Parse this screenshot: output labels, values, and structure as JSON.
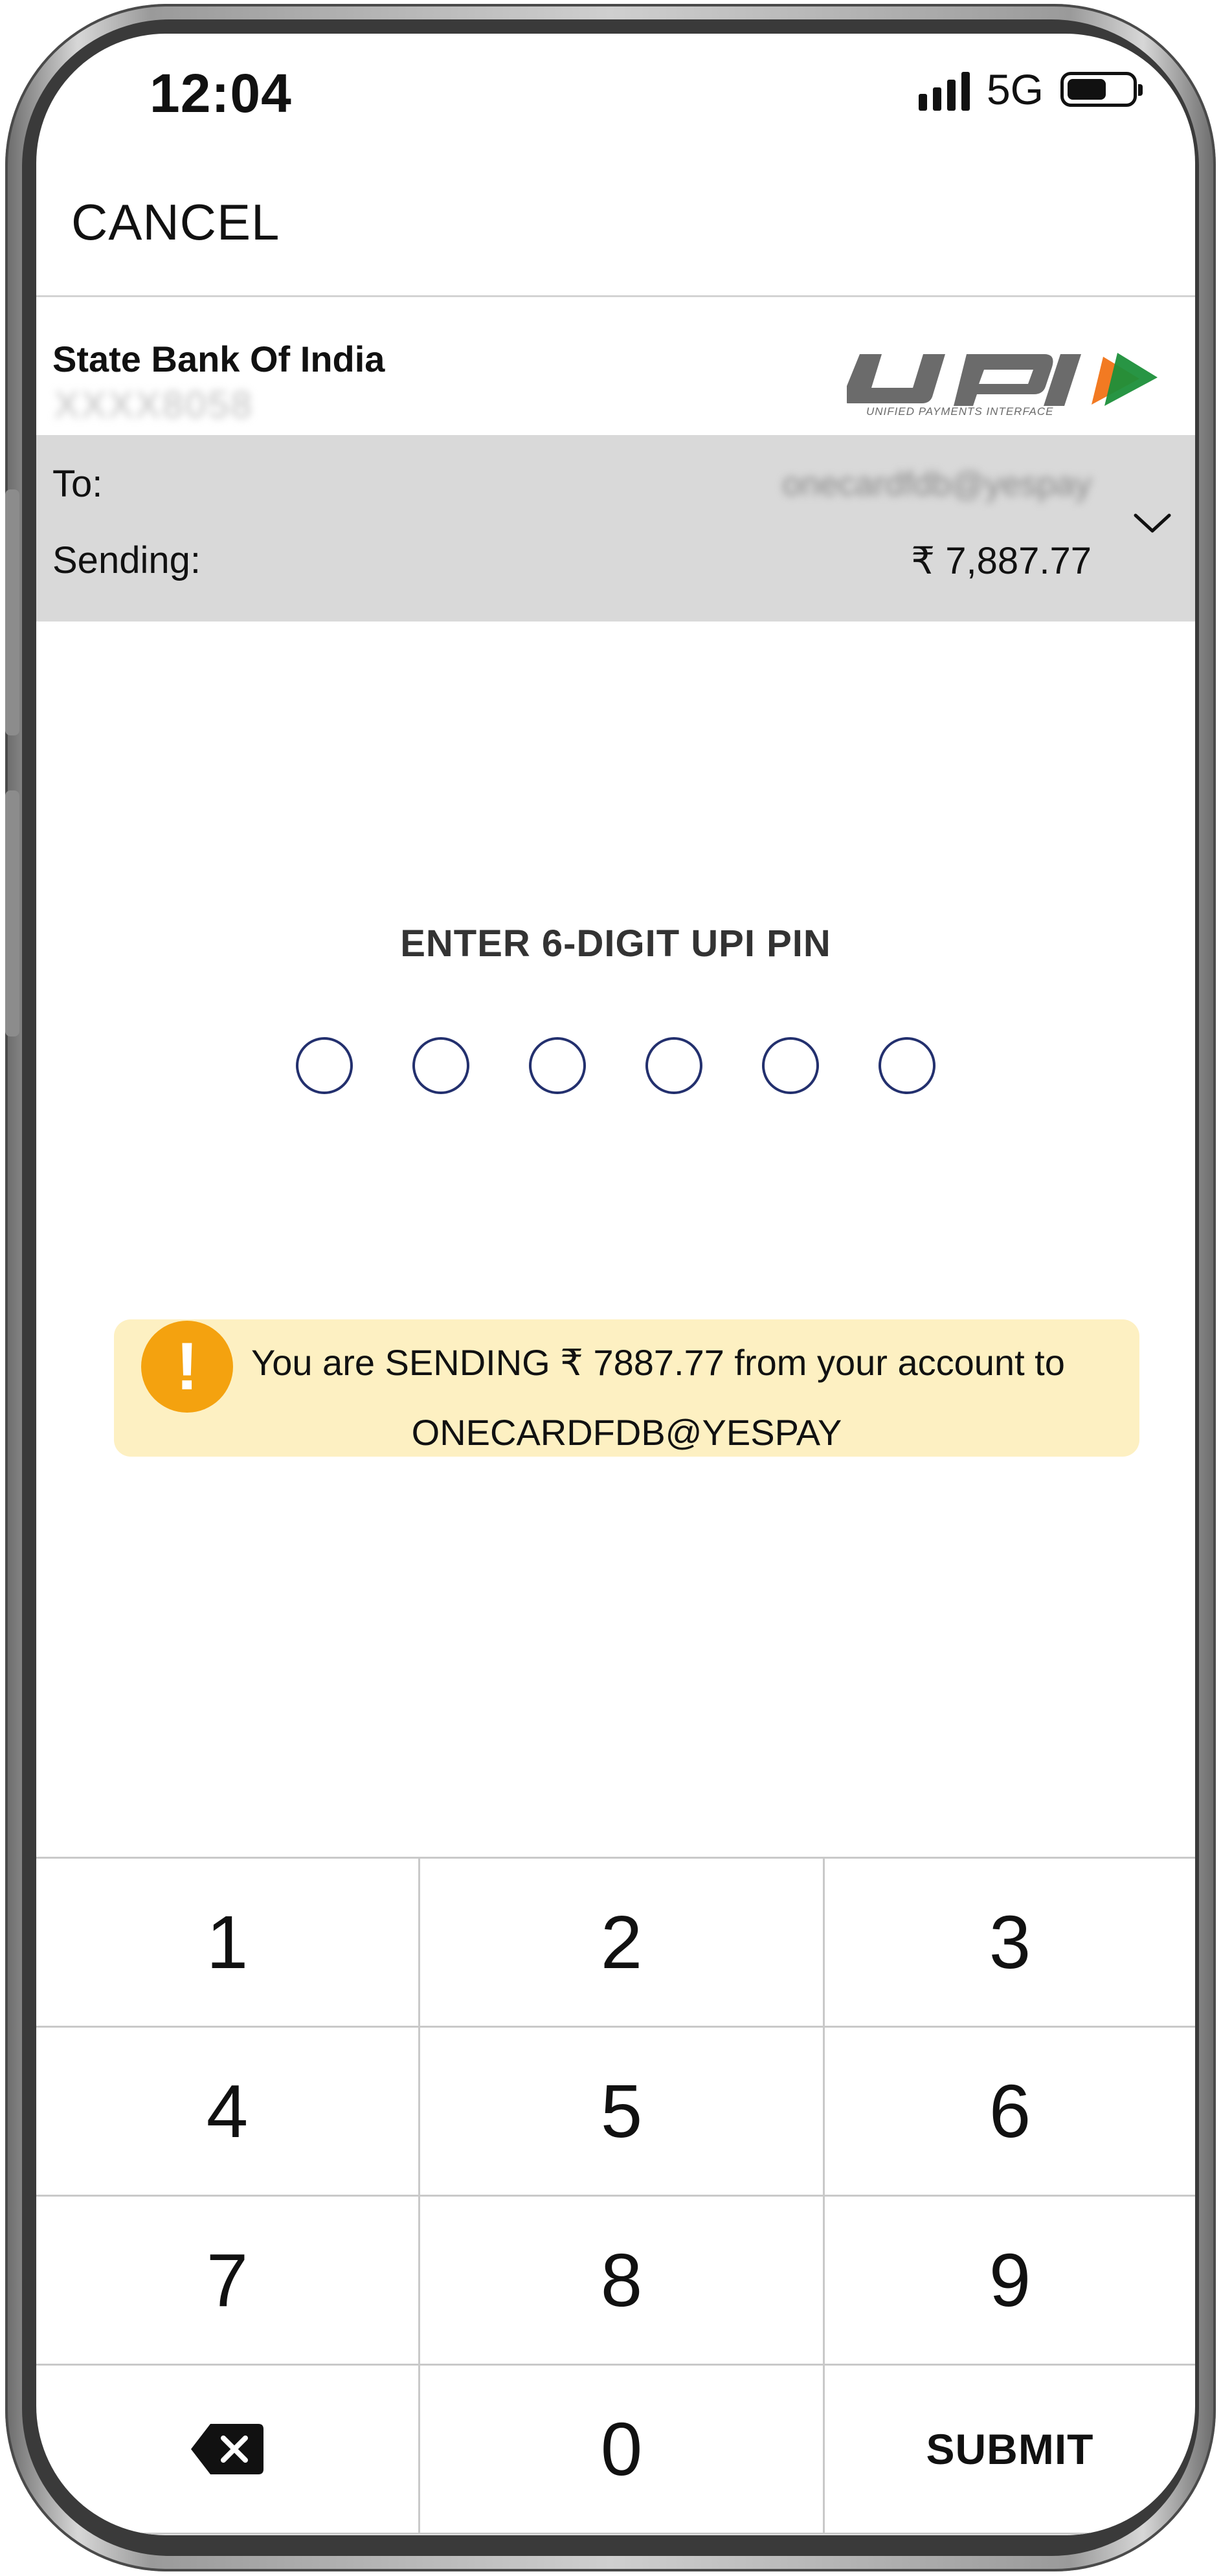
{
  "status_bar": {
    "time": "12:04",
    "network": "5G",
    "signal_icon": "signal-bars-icon",
    "battery_icon": "battery-icon"
  },
  "header": {
    "cancel_label": "CANCEL"
  },
  "account": {
    "bank_name": "State Bank Of India",
    "account_number_masked": "XXXX8058",
    "logo": "UPI — UNIFIED PAYMENTS INTERFACE"
  },
  "payment": {
    "to_label": "To:",
    "to_value": "onecardfdb@yespay",
    "sending_label": "Sending:",
    "sending_value": "₹ 7,887.77",
    "expand_icon": "chevron-down-icon"
  },
  "pin": {
    "title": "ENTER 6-DIGIT UPI PIN",
    "digits": 6,
    "filled": 0
  },
  "warning": {
    "icon": "exclamation-icon",
    "line1": "You are SENDING ₹ 7887.77 from your account to",
    "line2": "ONECARDFDB@YESPAY",
    "background": "#fdf0c2",
    "icon_color": "#f4a20f"
  },
  "keypad": {
    "keys": [
      "1",
      "2",
      "3",
      "4",
      "5",
      "6",
      "7",
      "8",
      "9",
      "",
      "0",
      "SUBMIT"
    ],
    "backspace_icon": "backspace-icon"
  }
}
